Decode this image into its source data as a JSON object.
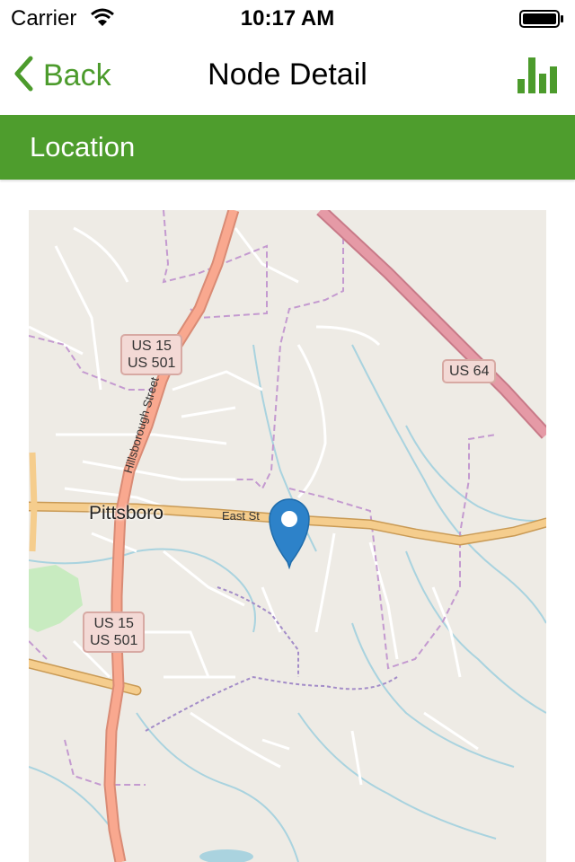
{
  "status_bar": {
    "carrier": "Carrier",
    "time": "10:17 AM"
  },
  "nav": {
    "back_label": "Back",
    "title": "Node Detail",
    "chart_icon": "bar-chart-icon"
  },
  "section": {
    "title": "Location"
  },
  "map": {
    "town": "Pittsboro",
    "street_east": "East St",
    "street_hillsborough": "Hillsborough Street",
    "shields": [
      {
        "line1": "US 15",
        "line2": "US 501"
      },
      {
        "line1": "US 64"
      },
      {
        "line1": "US 15",
        "line2": "US 501"
      }
    ],
    "marker_icon": "map-pin-icon"
  },
  "colors": {
    "accent": "#4c9b2c",
    "header": "#4e9d2d",
    "pin": "#2d82c9",
    "map_bg": "#eeebe5"
  }
}
